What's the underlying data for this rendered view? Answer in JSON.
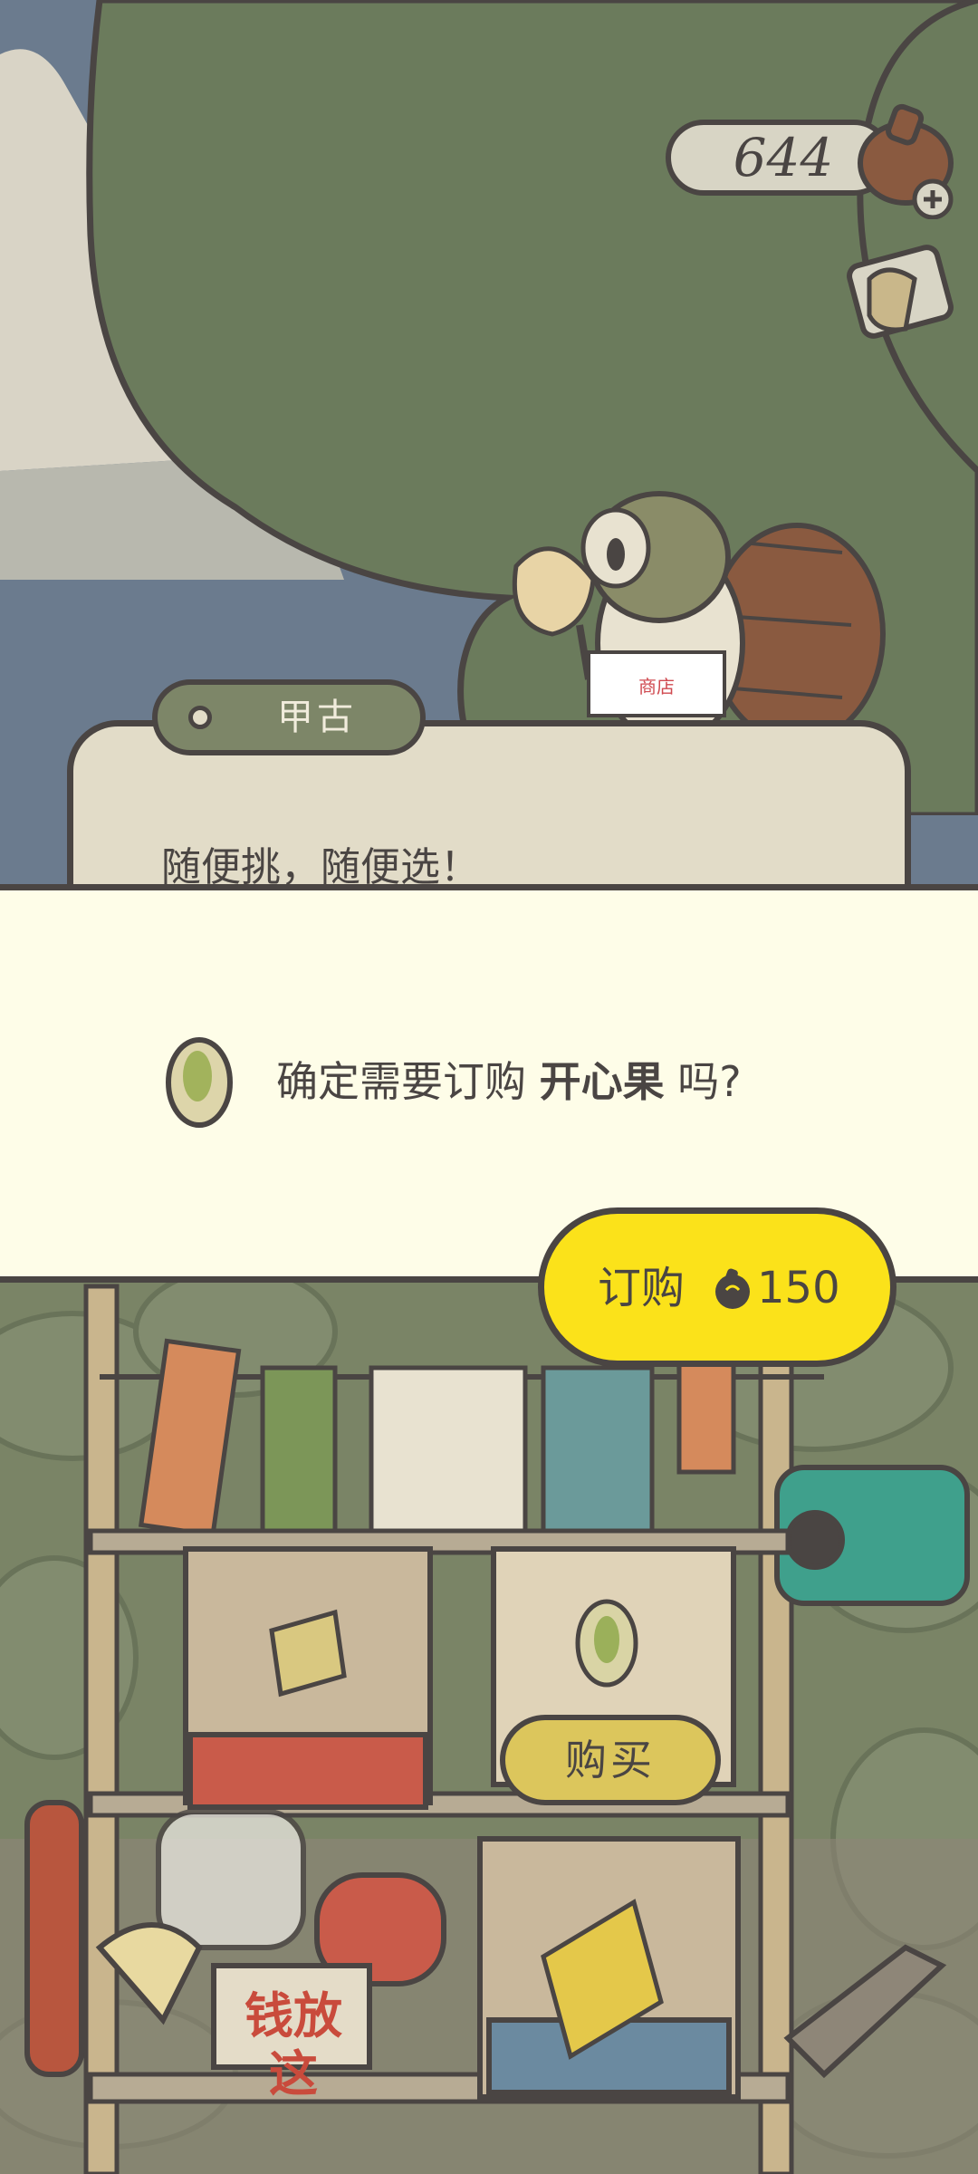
{
  "header": {
    "currency_value": "644",
    "currency_icon": "clover-icon",
    "add_icon": "plus-icon",
    "mail_icon": "mail-icon"
  },
  "dialog": {
    "speaker_name": "甲古",
    "text": "随便挑，随便选！"
  },
  "confirm": {
    "prefix": "确定需要订购 ",
    "item_name": "开心果",
    "suffix": " 吗?",
    "item_icon": "pistachio-icon"
  },
  "order_button": {
    "label": "订购",
    "price": "150",
    "price_icon": "clover-icon"
  },
  "stall": {
    "buy_label": "购买",
    "money_sign": "钱放这"
  },
  "colors": {
    "outline": "#4a4543",
    "tree_green": "#6b7b5c",
    "sky": "#6b7b8e",
    "panel_bg": "#fefde8",
    "order_yellow": "#fbe21a",
    "buy_yellow": "#dcc65c",
    "dialog_bg": "#e2dcc8"
  }
}
